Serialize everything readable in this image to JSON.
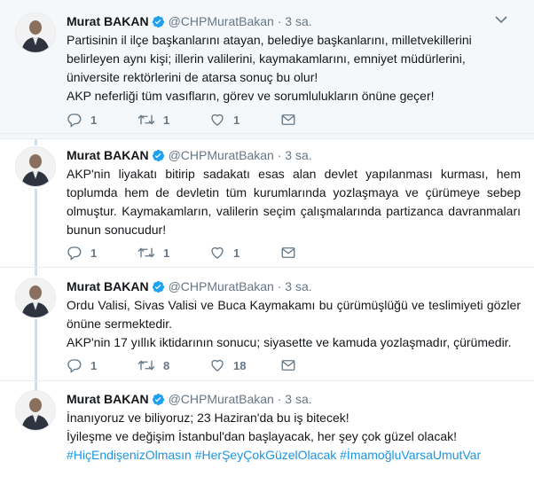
{
  "author": {
    "name": "Murat BAKAN",
    "handle": "@CHPMuratBakan",
    "separator": "·"
  },
  "colors": {
    "hashtag": "#1b95e0",
    "verified": "#1da1f2",
    "thread_line": "#c4e1f6",
    "muted": "#657786"
  },
  "tweets": [
    {
      "time": "3 sa.",
      "lines": [
        "Partisinin il ilçe başkanlarını atayan, belediye başkanlarını, milletvekillerini belirleyen aynı kişi; illerin valilerini, kaymakamlarını, emniyet müdürlerini, üniversite rektörlerini de atarsa sonuç bu olur!",
        "AKP neferliği tüm vasıfların, görev ve sorumlulukların önüne geçer!"
      ],
      "replies": "1",
      "retweets": "1",
      "likes": "1"
    },
    {
      "time": "3 sa.",
      "lines": [
        "AKP'nin liyakatı bitirip sadakatı esas alan devlet yapılanması kurması, hem toplumda hem de devletin tüm kurumlarında yozlaşmaya ve çürümeye sebep olmuştur. Kaymakamların, valilerin seçim çalışmalarında partizanca davranmaları bunun sonucudur!"
      ],
      "replies": "1",
      "retweets": "1",
      "likes": "1"
    },
    {
      "time": "3 sa.",
      "lines": [
        "Ordu Valisi, Sivas Valisi ve Buca Kaymakamı bu çürümüşlüğü ve teslimiyeti gözler önüne sermektedir.",
        "AKP'nin 17 yıllık iktidarının sonucu; siyasette ve kamuda yozlaşmadır, çürümedir."
      ],
      "replies": "1",
      "retweets": "8",
      "likes": "18"
    },
    {
      "time": "3 sa.",
      "lines": [
        "İnanıyoruz ve biliyoruz; 23 Haziran'da bu iş bitecek!",
        "İyileşme ve değişim İstanbul'dan başlayacak, her şey çok güzel olacak!"
      ],
      "hashtags": [
        "#HiçEndişenizOlmasın",
        "#HerŞeyÇokGüzelOlacak",
        "#İmamoğluVarsaUmutVar"
      ]
    }
  ]
}
